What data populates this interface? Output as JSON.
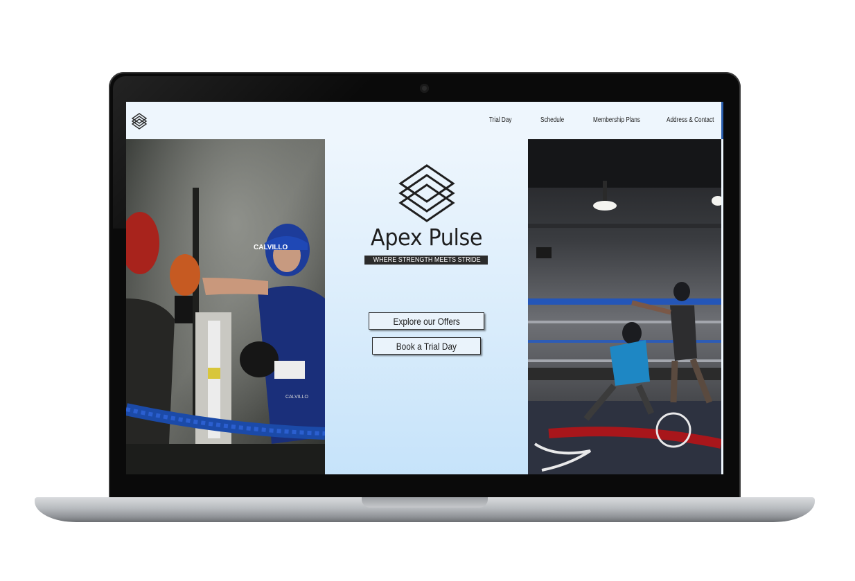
{
  "nav": {
    "links": [
      {
        "label": "Trial Day"
      },
      {
        "label": "Schedule"
      },
      {
        "label": "Membership Plans"
      },
      {
        "label": "Address & Contact"
      }
    ]
  },
  "hero": {
    "brand": "Apex Pulse",
    "tagline": "WHERE STRENGTH MEETS STRIDE",
    "buttons": {
      "explore": "Explore our Offers",
      "trial": "Book a Trial Day"
    }
  },
  "photos": {
    "left_headgear_text": "CALVILLO",
    "left_shorts_text": "CALVILLO"
  },
  "colors": {
    "page_background": "#eef6fd",
    "hero_gradient_bottom": "#c6e3fa",
    "tagline_background": "#2b2b2b",
    "accent_edge": "#2b5fae"
  },
  "icons": {
    "brand_logo": "stacked-diamond-layers-icon"
  }
}
